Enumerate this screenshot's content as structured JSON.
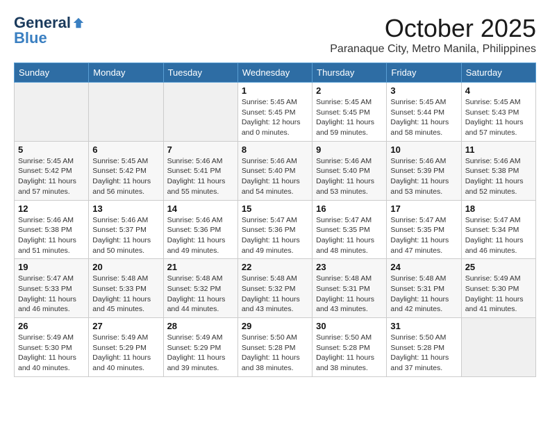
{
  "header": {
    "logo_general": "General",
    "logo_blue": "Blue",
    "month_title": "October 2025",
    "location": "Paranaque City, Metro Manila, Philippines"
  },
  "weekdays": [
    "Sunday",
    "Monday",
    "Tuesday",
    "Wednesday",
    "Thursday",
    "Friday",
    "Saturday"
  ],
  "weeks": [
    [
      {
        "day": "",
        "info": ""
      },
      {
        "day": "",
        "info": ""
      },
      {
        "day": "",
        "info": ""
      },
      {
        "day": "1",
        "info": "Sunrise: 5:45 AM\nSunset: 5:45 PM\nDaylight: 12 hours\nand 0 minutes."
      },
      {
        "day": "2",
        "info": "Sunrise: 5:45 AM\nSunset: 5:45 PM\nDaylight: 11 hours\nand 59 minutes."
      },
      {
        "day": "3",
        "info": "Sunrise: 5:45 AM\nSunset: 5:44 PM\nDaylight: 11 hours\nand 58 minutes."
      },
      {
        "day": "4",
        "info": "Sunrise: 5:45 AM\nSunset: 5:43 PM\nDaylight: 11 hours\nand 57 minutes."
      }
    ],
    [
      {
        "day": "5",
        "info": "Sunrise: 5:45 AM\nSunset: 5:42 PM\nDaylight: 11 hours\nand 57 minutes."
      },
      {
        "day": "6",
        "info": "Sunrise: 5:45 AM\nSunset: 5:42 PM\nDaylight: 11 hours\nand 56 minutes."
      },
      {
        "day": "7",
        "info": "Sunrise: 5:46 AM\nSunset: 5:41 PM\nDaylight: 11 hours\nand 55 minutes."
      },
      {
        "day": "8",
        "info": "Sunrise: 5:46 AM\nSunset: 5:40 PM\nDaylight: 11 hours\nand 54 minutes."
      },
      {
        "day": "9",
        "info": "Sunrise: 5:46 AM\nSunset: 5:40 PM\nDaylight: 11 hours\nand 53 minutes."
      },
      {
        "day": "10",
        "info": "Sunrise: 5:46 AM\nSunset: 5:39 PM\nDaylight: 11 hours\nand 53 minutes."
      },
      {
        "day": "11",
        "info": "Sunrise: 5:46 AM\nSunset: 5:38 PM\nDaylight: 11 hours\nand 52 minutes."
      }
    ],
    [
      {
        "day": "12",
        "info": "Sunrise: 5:46 AM\nSunset: 5:38 PM\nDaylight: 11 hours\nand 51 minutes."
      },
      {
        "day": "13",
        "info": "Sunrise: 5:46 AM\nSunset: 5:37 PM\nDaylight: 11 hours\nand 50 minutes."
      },
      {
        "day": "14",
        "info": "Sunrise: 5:46 AM\nSunset: 5:36 PM\nDaylight: 11 hours\nand 49 minutes."
      },
      {
        "day": "15",
        "info": "Sunrise: 5:47 AM\nSunset: 5:36 PM\nDaylight: 11 hours\nand 49 minutes."
      },
      {
        "day": "16",
        "info": "Sunrise: 5:47 AM\nSunset: 5:35 PM\nDaylight: 11 hours\nand 48 minutes."
      },
      {
        "day": "17",
        "info": "Sunrise: 5:47 AM\nSunset: 5:35 PM\nDaylight: 11 hours\nand 47 minutes."
      },
      {
        "day": "18",
        "info": "Sunrise: 5:47 AM\nSunset: 5:34 PM\nDaylight: 11 hours\nand 46 minutes."
      }
    ],
    [
      {
        "day": "19",
        "info": "Sunrise: 5:47 AM\nSunset: 5:33 PM\nDaylight: 11 hours\nand 46 minutes."
      },
      {
        "day": "20",
        "info": "Sunrise: 5:48 AM\nSunset: 5:33 PM\nDaylight: 11 hours\nand 45 minutes."
      },
      {
        "day": "21",
        "info": "Sunrise: 5:48 AM\nSunset: 5:32 PM\nDaylight: 11 hours\nand 44 minutes."
      },
      {
        "day": "22",
        "info": "Sunrise: 5:48 AM\nSunset: 5:32 PM\nDaylight: 11 hours\nand 43 minutes."
      },
      {
        "day": "23",
        "info": "Sunrise: 5:48 AM\nSunset: 5:31 PM\nDaylight: 11 hours\nand 43 minutes."
      },
      {
        "day": "24",
        "info": "Sunrise: 5:48 AM\nSunset: 5:31 PM\nDaylight: 11 hours\nand 42 minutes."
      },
      {
        "day": "25",
        "info": "Sunrise: 5:49 AM\nSunset: 5:30 PM\nDaylight: 11 hours\nand 41 minutes."
      }
    ],
    [
      {
        "day": "26",
        "info": "Sunrise: 5:49 AM\nSunset: 5:30 PM\nDaylight: 11 hours\nand 40 minutes."
      },
      {
        "day": "27",
        "info": "Sunrise: 5:49 AM\nSunset: 5:29 PM\nDaylight: 11 hours\nand 40 minutes."
      },
      {
        "day": "28",
        "info": "Sunrise: 5:49 AM\nSunset: 5:29 PM\nDaylight: 11 hours\nand 39 minutes."
      },
      {
        "day": "29",
        "info": "Sunrise: 5:50 AM\nSunset: 5:28 PM\nDaylight: 11 hours\nand 38 minutes."
      },
      {
        "day": "30",
        "info": "Sunrise: 5:50 AM\nSunset: 5:28 PM\nDaylight: 11 hours\nand 38 minutes."
      },
      {
        "day": "31",
        "info": "Sunrise: 5:50 AM\nSunset: 5:28 PM\nDaylight: 11 hours\nand 37 minutes."
      },
      {
        "day": "",
        "info": ""
      }
    ]
  ]
}
